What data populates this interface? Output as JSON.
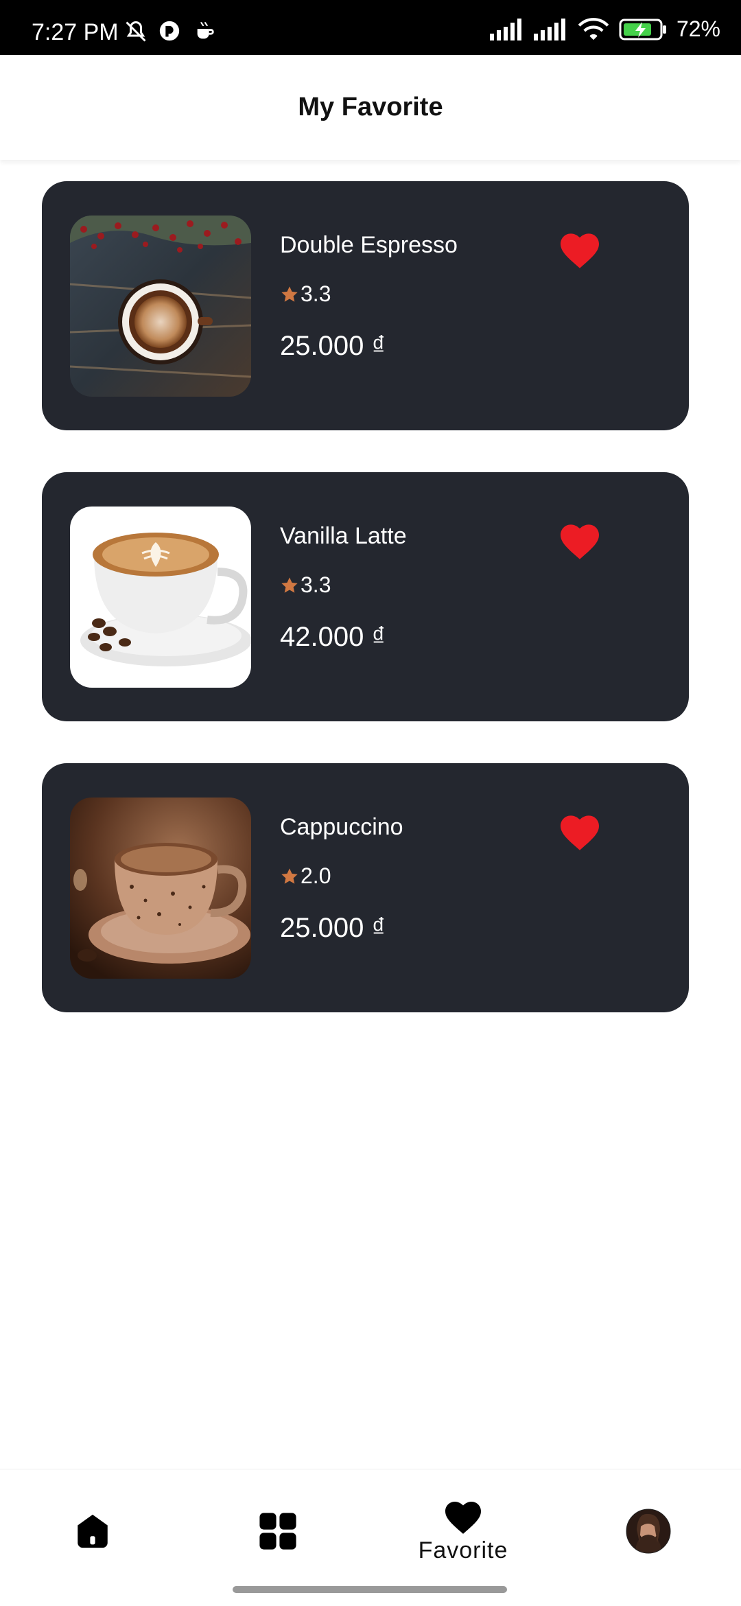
{
  "status_bar": {
    "time": "7:27 PM",
    "battery": "72%"
  },
  "header": {
    "title": "My Favorite"
  },
  "favorites": [
    {
      "name": "Double Espresso",
      "rating": "3.3",
      "price": "25.000 ₫",
      "image": "espresso-cup-on-wood-image"
    },
    {
      "name": "Vanilla Latte",
      "rating": "3.3",
      "price": "42.000 ₫",
      "image": "latte-cup-image"
    },
    {
      "name": "Cappuccino",
      "rating": "2.0",
      "price": "25.000 ₫",
      "image": "cappuccino-cup-image"
    }
  ],
  "nav": {
    "items": [
      {
        "name": "home",
        "icon": "home-icon"
      },
      {
        "name": "categories",
        "icon": "grid-icon"
      },
      {
        "name": "favorite",
        "icon": "heart-icon",
        "label": "Favorite",
        "active": true
      },
      {
        "name": "profile",
        "icon": "avatar"
      }
    ]
  },
  "colors": {
    "card_bg": "#24272f",
    "heart": "#ec1c24",
    "star": "#d17842"
  }
}
